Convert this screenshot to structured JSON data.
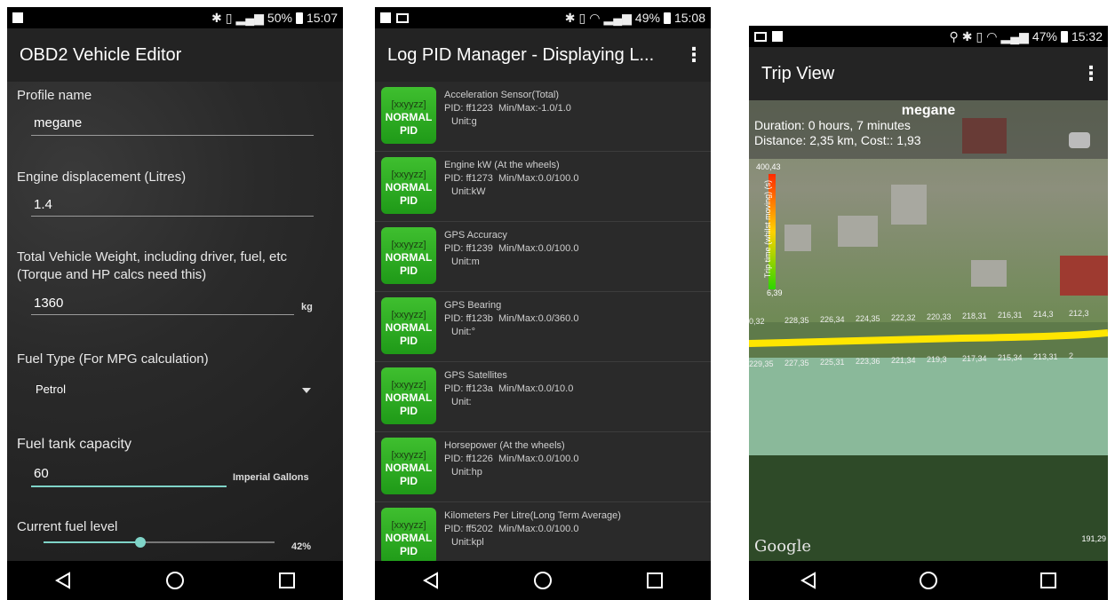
{
  "nav_icons": [
    "back-triangle-icon",
    "home-circle-icon",
    "recents-square-icon"
  ],
  "screen1": {
    "status": {
      "battery": "50%",
      "time": "15:07"
    },
    "title": "OBD2 Vehicle Editor",
    "profile_label": "Profile name",
    "profile_value": "megane",
    "engine_label": "Engine displacement (Litres)",
    "engine_value": "1.4",
    "weight_label": "Total Vehicle Weight, including driver, fuel, etc (Torque and HP calcs need this)",
    "weight_value": "1360",
    "weight_unit": "kg",
    "fuel_type_label": "Fuel Type (For MPG calculation)",
    "fuel_type_value": "Petrol",
    "tank_label": "Fuel tank capacity",
    "tank_value": "60",
    "tank_unit": "Imperial Gallons",
    "level_label": "Current fuel level",
    "level_value": "42%",
    "level_fraction": 0.42,
    "accent": "#7fd4c8"
  },
  "screen2": {
    "status": {
      "battery": "49%",
      "time": "15:08"
    },
    "title": "Log PID Manager - Displaying L...",
    "badge_code": "[xxyyzz]",
    "badge_kind_1": "NORMAL",
    "badge_kind_2": "PID",
    "badge_color": "#2bab22",
    "items": [
      {
        "name": "Acceleration Sensor(Total)",
        "pid": "PID: ff1223",
        "minmax": "Min/Max:-1.0/1.0",
        "unit": "Unit:g"
      },
      {
        "name": "Engine kW (At the wheels)",
        "pid": "PID: ff1273",
        "minmax": "Min/Max:0.0/100.0",
        "unit": "Unit:kW"
      },
      {
        "name": "GPS Accuracy",
        "pid": "PID: ff1239",
        "minmax": "Min/Max:0.0/100.0",
        "unit": "Unit:m"
      },
      {
        "name": "GPS Bearing",
        "pid": "PID: ff123b",
        "minmax": "Min/Max:0.0/360.0",
        "unit": "Unit:°"
      },
      {
        "name": "GPS Satellites",
        "pid": "PID: ff123a",
        "minmax": "Min/Max:0.0/10.0",
        "unit": "Unit:"
      },
      {
        "name": "Horsepower (At the wheels)",
        "pid": "PID: ff1226",
        "minmax": "Min/Max:0.0/100.0",
        "unit": "Unit:hp"
      },
      {
        "name": "Kilometers Per Litre(Long Term Average)",
        "pid": "PID: ff5202",
        "minmax": "Min/Max:0.0/100.0",
        "unit": "Unit:kpl"
      }
    ]
  },
  "screen3": {
    "status": {
      "battery": "47%",
      "time": "15:32"
    },
    "title": "Trip View",
    "trip_name": "megane",
    "duration": "Duration: 0 hours, 7 minutes",
    "distance": "Distance: 2,35 km, Cost:: 1,93",
    "scale_max": "400,43",
    "scale_min": "6,39",
    "scale_label": "Trip time (whilst moving) (s)",
    "elev_top": [
      "0,32",
      "228,35",
      "226,34",
      "224,35",
      "222,32",
      "220,33",
      "218,31",
      "216,31",
      "214,3",
      "212,3"
    ],
    "elev_bottom": [
      "229,35",
      "227,35",
      "225,31",
      "223,36",
      "221,34",
      "219,3",
      "217,34",
      "215,34",
      "213,31",
      "2"
    ],
    "corner_value": "191,29",
    "attribution": "Google",
    "route_color": "#ffe600"
  }
}
